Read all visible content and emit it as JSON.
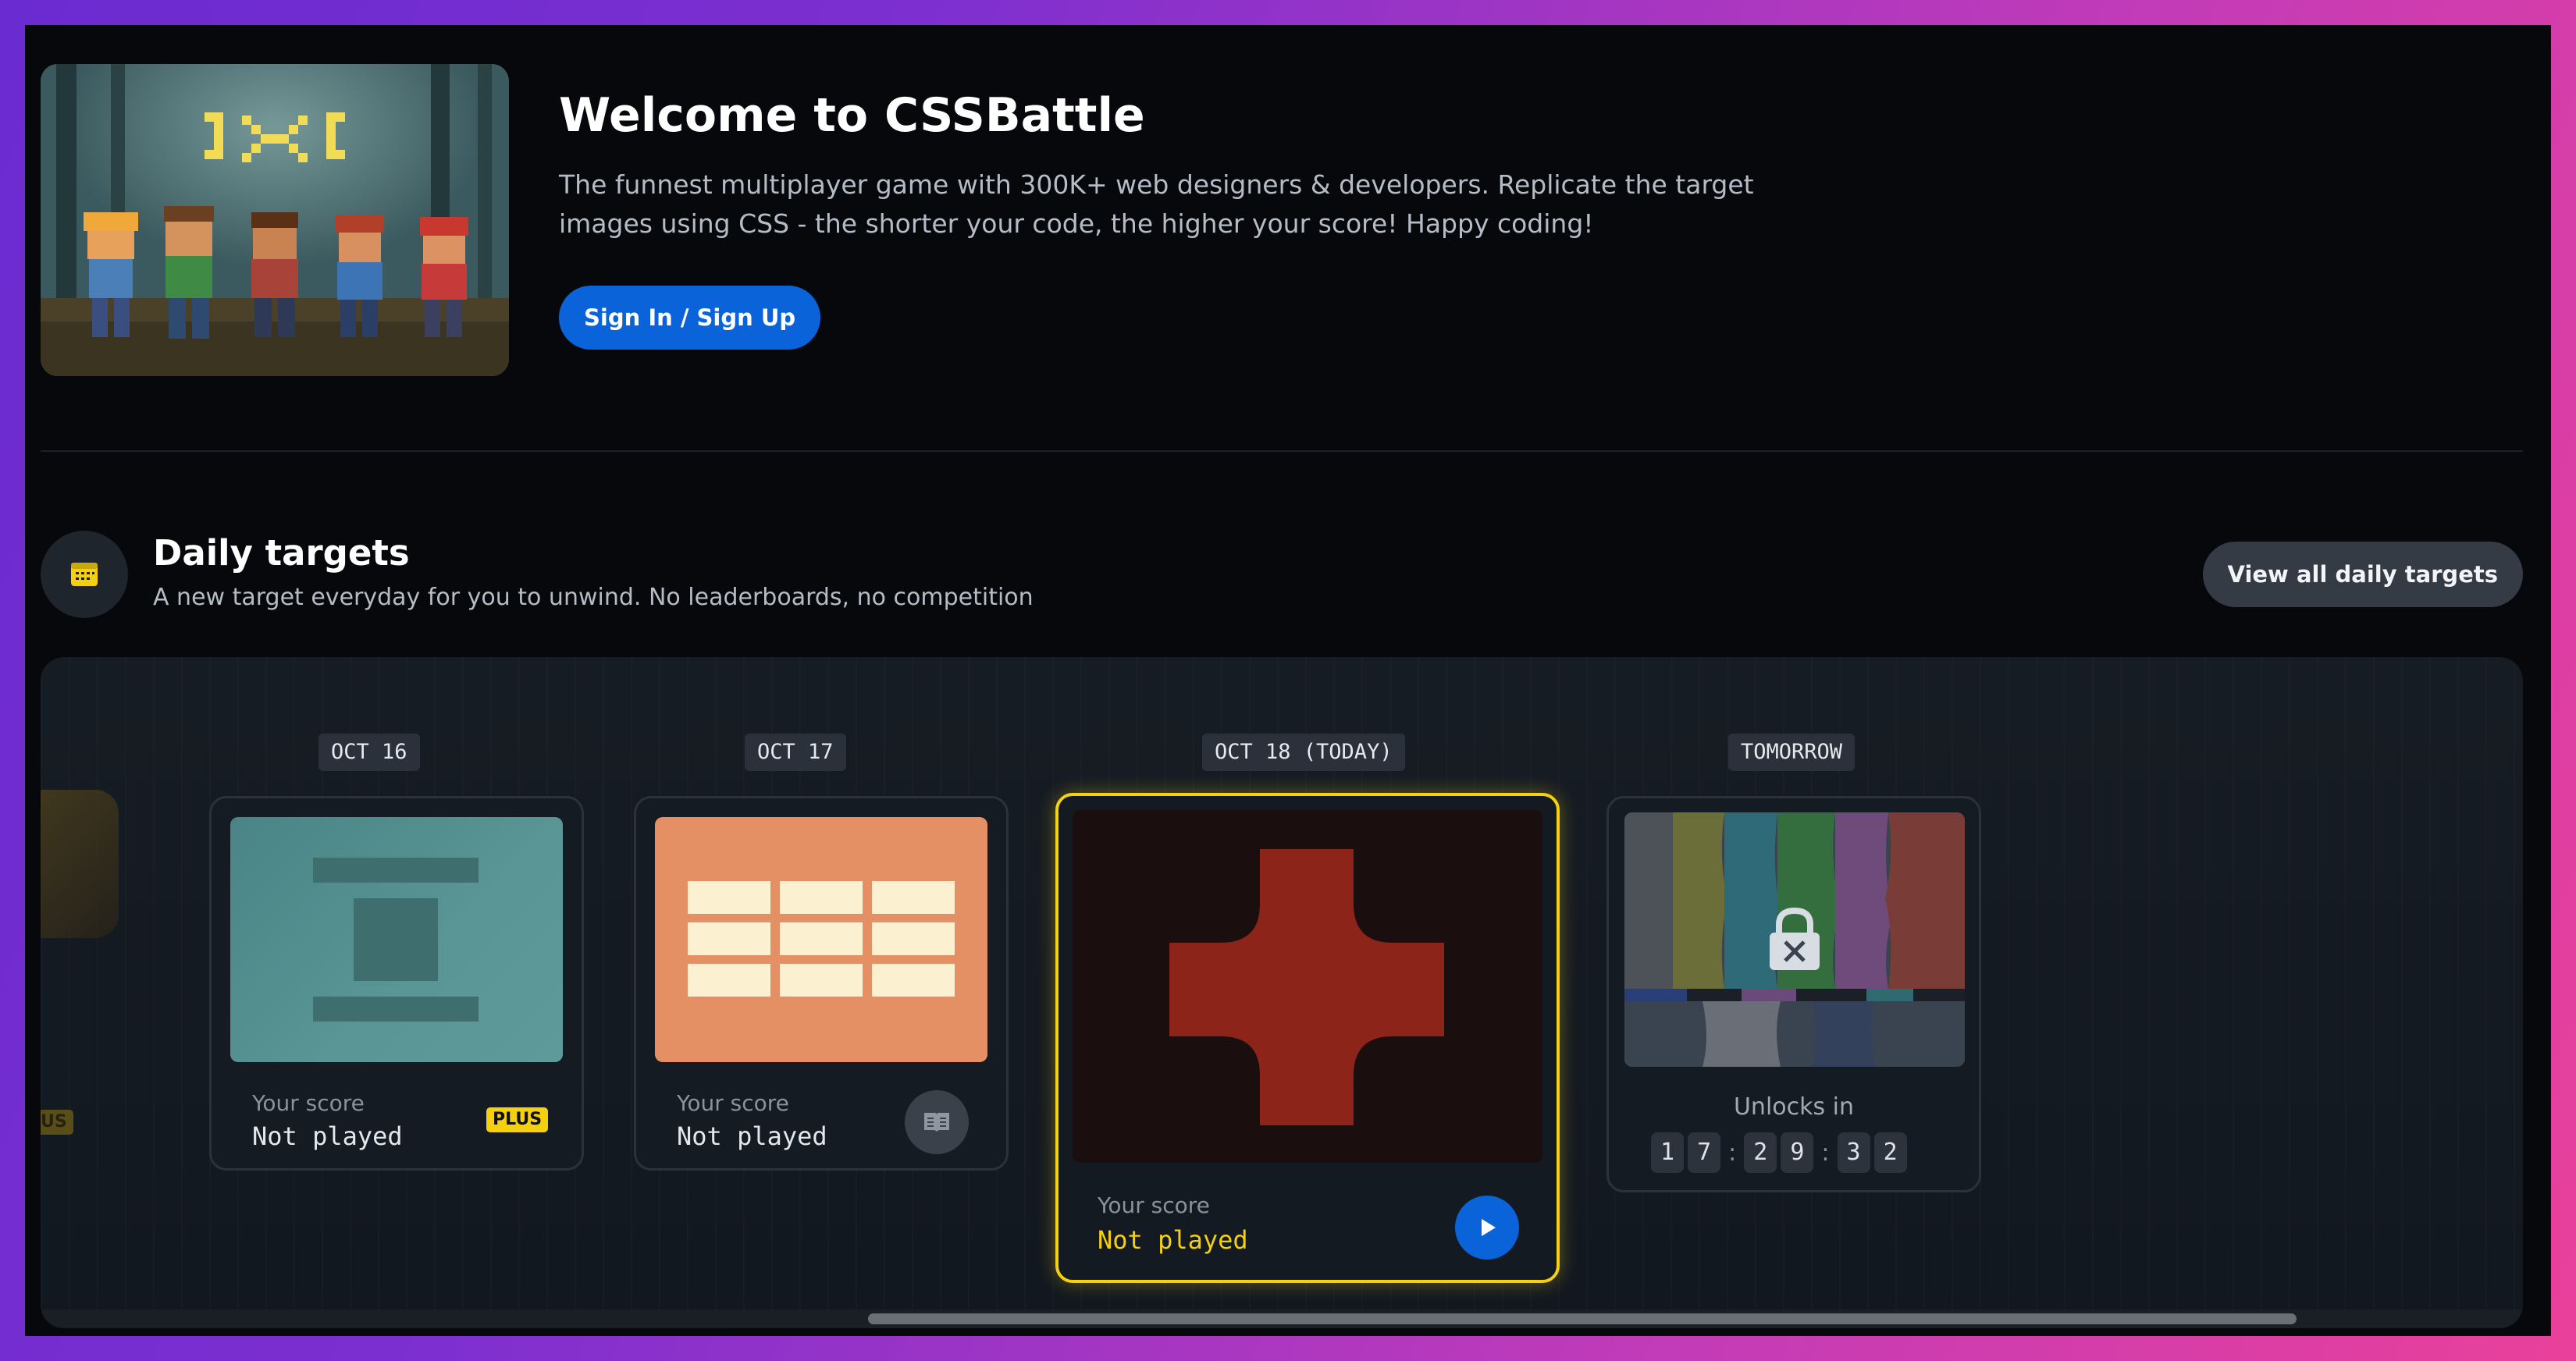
{
  "hero": {
    "title": "Welcome to CSSBattle",
    "description": "The funnest multiplayer game with 300K+ web designers & developers. Replicate the target images using CSS - the shorter your code, the higher your score! Happy coding!",
    "signin_label": "Sign In / Sign Up"
  },
  "daily": {
    "title": "Daily targets",
    "subtitle": "A new target everyday for you to unwind. No leaderboards, no competition",
    "view_all_label": "View all daily targets",
    "partial_badge": "US"
  },
  "cards": [
    {
      "date": "OCT 16",
      "score_label": "Your score",
      "score_value": "Not played",
      "badge": "PLUS",
      "thumb_bg": "#5a9494"
    },
    {
      "date": "OCT 17",
      "score_label": "Your score",
      "score_value": "Not played",
      "thumb_bg": "#e49064"
    },
    {
      "date": "OCT 18 (TODAY)",
      "score_label": "Your score",
      "score_value": "Not played",
      "thumb_bg": "#1a0f0e",
      "shape_color": "#8c2419"
    },
    {
      "date": "TOMORROW",
      "unlocks_label": "Unlocks in",
      "timer_digits": [
        "1",
        "7",
        "2",
        "9",
        "3",
        "2"
      ],
      "timer_separator": ":"
    }
  ],
  "colors": {
    "accent_blue": "#0a63d8",
    "highlight_yellow": "#f5d00e",
    "background": "#06080b"
  },
  "icons": {
    "calendar": "calendar-icon",
    "book": "book-icon",
    "play": "play-icon",
    "lock": "lock-icon"
  }
}
